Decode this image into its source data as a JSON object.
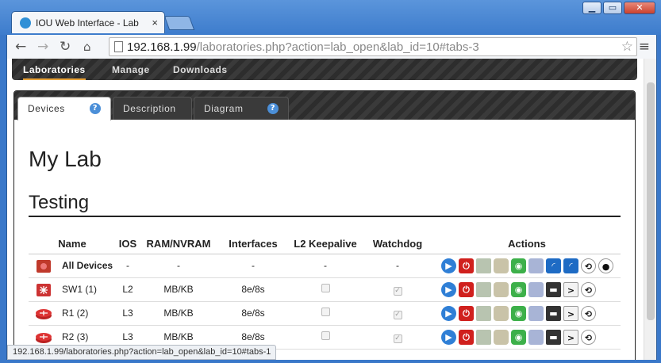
{
  "browser": {
    "tab_title": "IOU Web Interface - Lab",
    "tab_close": "×",
    "url_host": "192.168.1.99",
    "url_path": "/laboratories.php?action=lab_open&lab_id=10#tabs-3",
    "status_url": "192.168.1.99/laboratories.php?action=lab_open&lab_id=10#tabs-1",
    "min": "▁",
    "max": "▭",
    "close": "✕"
  },
  "topnav": {
    "items": [
      "Laboratories",
      "Manage",
      "Downloads"
    ],
    "active": 0
  },
  "tabs": {
    "items": [
      "Devices",
      "Description",
      "Diagram"
    ],
    "active": 0,
    "help_glyph": "?"
  },
  "lab": {
    "title": "My Lab",
    "section": "Testing"
  },
  "table": {
    "headers": [
      "Name",
      "IOS",
      "RAM/NVRAM",
      "Interfaces",
      "L2 Keepalive",
      "Watchdog",
      "Actions"
    ],
    "rows": [
      {
        "name": "All Devices",
        "ios": "-",
        "ram": "-",
        "ifaces": "-",
        "keepalive": "-",
        "watchdog": "-",
        "icon": "all-devices-icon"
      },
      {
        "name": "SW1 (1)",
        "ios": "L2",
        "ram": "MB/KB",
        "ifaces": "8e/8s",
        "keepalive": "unchecked",
        "watchdog": "checked",
        "icon": "switch-icon"
      },
      {
        "name": "R1 (2)",
        "ios": "L3",
        "ram": "MB/KB",
        "ifaces": "8e/8s",
        "keepalive": "unchecked",
        "watchdog": "checked",
        "icon": "router-icon"
      },
      {
        "name": "R2 (3)",
        "ios": "L3",
        "ram": "MB/KB",
        "ifaces": "8e/8s",
        "keepalive": "unchecked",
        "watchdog": "checked",
        "icon": "router-icon"
      }
    ]
  },
  "colors": {
    "accent": "#e8a33a",
    "start": "#2f7fd6",
    "stop": "#d0201d",
    "chrome": "#3d7ccc"
  }
}
